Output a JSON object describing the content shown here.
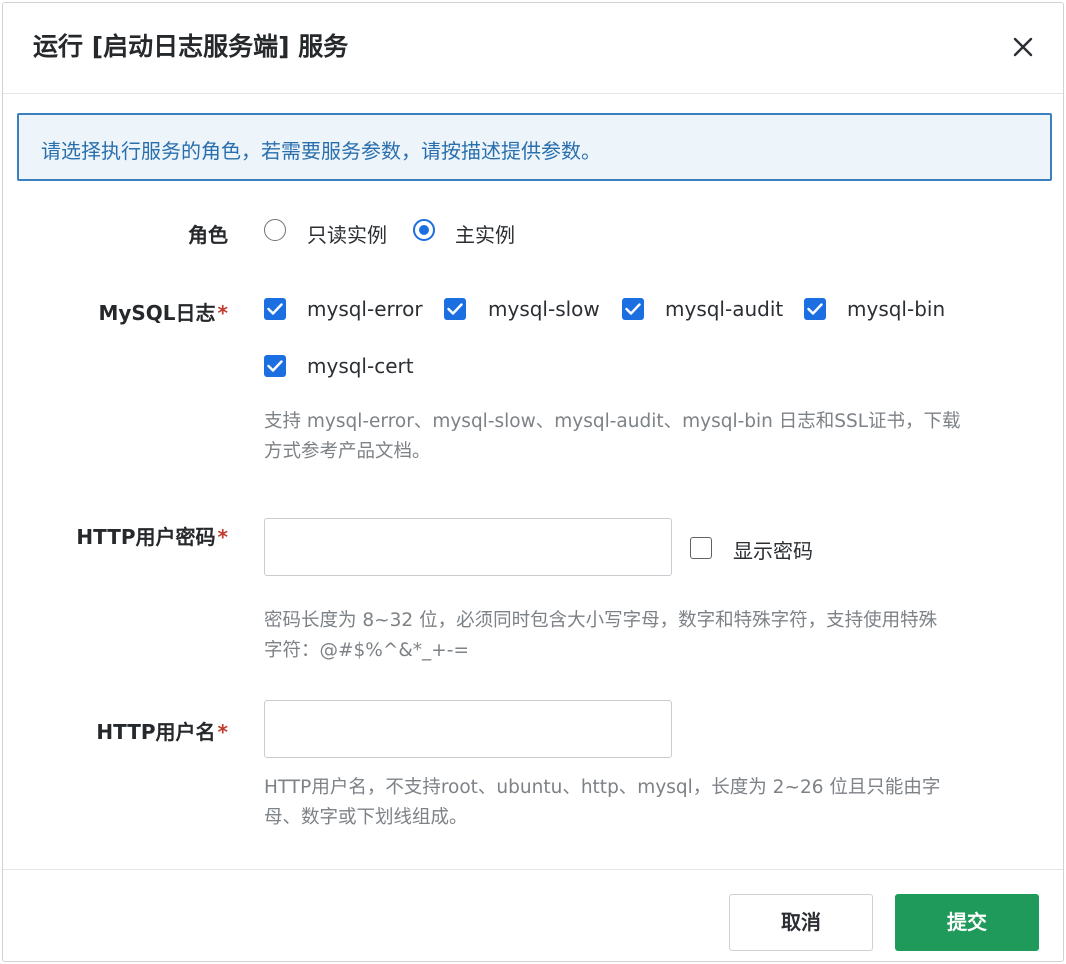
{
  "dialog": {
    "title": "运行 [启动日志服务端] 服务",
    "alert": "请选择执行服务的角色，若需要服务参数，请按描述提供参数。"
  },
  "role": {
    "label": "角色",
    "options": [
      {
        "label": "只读实例",
        "selected": false
      },
      {
        "label": "主实例",
        "selected": true
      }
    ]
  },
  "mysql_log": {
    "label": "MySQL日志",
    "required_mark": "*",
    "options": [
      {
        "label": "mysql-error",
        "checked": true
      },
      {
        "label": "mysql-slow",
        "checked": true
      },
      {
        "label": "mysql-audit",
        "checked": true
      },
      {
        "label": "mysql-bin",
        "checked": true
      },
      {
        "label": "mysql-cert",
        "checked": true
      }
    ],
    "help_line1": "支持 mysql-error、mysql-slow、mysql-audit、mysql-bin 日志和SSL证书，下载",
    "help_line2": "方式参考产品文档。"
  },
  "http_password": {
    "label": "HTTP用户密码",
    "required_mark": "*",
    "value": "",
    "show_password_label": "显示密码",
    "show_password_checked": false,
    "help_line1": "密码长度为 8~32 位，必须同时包含大小写字母，数字和特殊字符，支持使用特殊",
    "help_line2": "字符：@#$%^&*_+-="
  },
  "http_username": {
    "label": "HTTP用户名",
    "required_mark": "*",
    "value": "",
    "help_line1": "HTTP用户名，不支持root、ubuntu、http、mysql，长度为 2~26 位且只能由字",
    "help_line2": "母、数字或下划线组成。"
  },
  "footer": {
    "cancel_label": "取消",
    "submit_label": "提交"
  },
  "colors": {
    "primary": "#1b6fe0",
    "submit": "#1f9a5a",
    "alert_border": "#3b7fbf",
    "required": "#c0392b"
  }
}
